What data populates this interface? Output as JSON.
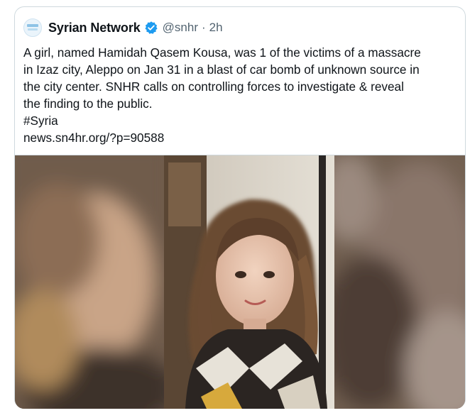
{
  "tweet": {
    "author_name": "Syrian Network",
    "handle": "@snhr",
    "separator": "·",
    "time": "2h",
    "lines": [
      "A girl, named Hamidah Qasem Kousa, was 1 of the victims of a massacre",
      "in Izaz city, Aleppo on Jan 31 in a blast of car bomb of unknown source in",
      "the city center. SNHR calls on controlling forces to investigate & reveal",
      "the finding to the public."
    ],
    "hashtag": "#Syria",
    "link": "news.sn4hr.org/?p=90588",
    "icons": {
      "avatar": "snhr-logo-icon",
      "verified": "verified-badge-icon"
    },
    "colors": {
      "verified": "#1d9bf0",
      "secondary_text": "#536471",
      "border": "#cfd9de"
    }
  }
}
